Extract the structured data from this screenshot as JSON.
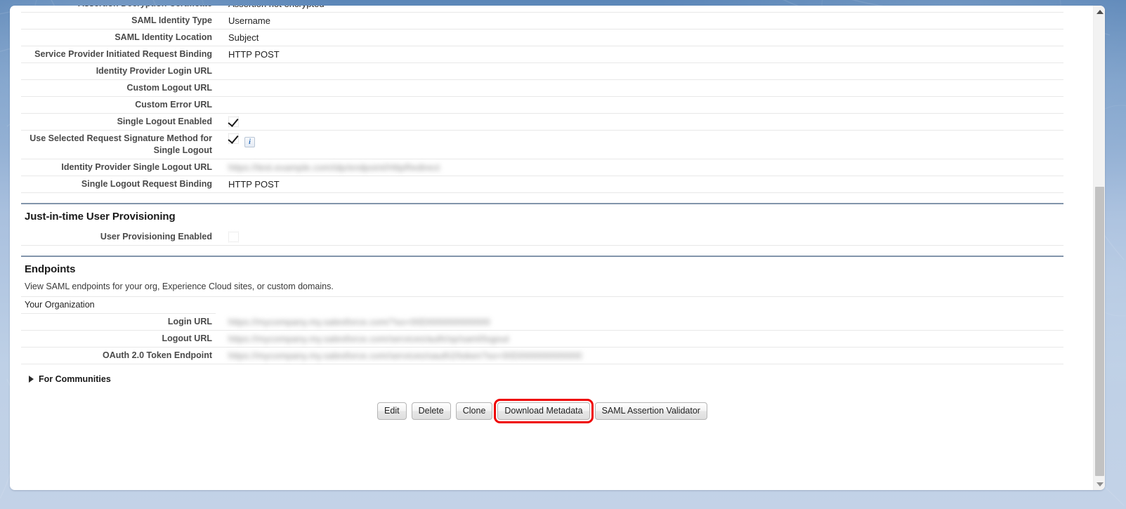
{
  "window": {
    "scrollbar": {
      "up_arrow": "scroll-up",
      "down_arrow": "scroll-down"
    }
  },
  "details": {
    "rows": [
      {
        "label": "Assertion Decryption Certificate",
        "value": "Assertion not encrypted",
        "type": "text"
      },
      {
        "label": "SAML Identity Type",
        "value": "Username",
        "type": "text"
      },
      {
        "label": "SAML Identity Location",
        "value": "Subject",
        "type": "text"
      },
      {
        "label": "Service Provider Initiated Request Binding",
        "value": "HTTP POST",
        "type": "text"
      },
      {
        "label": "Identity Provider Login URL",
        "value": "",
        "type": "text"
      },
      {
        "label": "Custom Logout URL",
        "value": "",
        "type": "text"
      },
      {
        "label": "Custom Error URL",
        "value": "",
        "type": "text"
      },
      {
        "label": "Single Logout Enabled",
        "value": "checked",
        "type": "checkbox"
      },
      {
        "label": "Use Selected Request Signature Method for Single Logout",
        "value": "checked",
        "type": "checkbox-info",
        "info_icon": "info-icon"
      },
      {
        "label": "Identity Provider Single Logout URL",
        "value": "https://test.example.com/idp/endpoint/HttpRedirect",
        "type": "redacted"
      },
      {
        "label": "Single Logout Request Binding",
        "value": "HTTP POST",
        "type": "text"
      }
    ]
  },
  "jit": {
    "title": "Just-in-time User Provisioning",
    "rows": [
      {
        "label": "User Provisioning Enabled",
        "value": "unchecked",
        "type": "checkbox"
      }
    ]
  },
  "endpoints": {
    "title": "Endpoints",
    "description": "View SAML endpoints for your org, Experience Cloud sites, or custom domains.",
    "subhead": "Your Organization",
    "rows": [
      {
        "label": "Login URL",
        "value": "https://mycompany.my.salesforce.com/?so=00D000000000000",
        "type": "redacted"
      },
      {
        "label": "Logout URL",
        "value": "https://mycompany.my.salesforce.com/services/auth/sp/saml/logout",
        "type": "redacted"
      },
      {
        "label": "OAuth 2.0 Token Endpoint",
        "value": "https://mycompany.my.salesforce.com/services/oauth2/token?so=00D000000000000",
        "type": "redacted"
      }
    ],
    "communities_label": "For Communities"
  },
  "actions": {
    "buttons": [
      {
        "label": "Edit",
        "highlighted": false
      },
      {
        "label": "Delete",
        "highlighted": false
      },
      {
        "label": "Clone",
        "highlighted": false
      },
      {
        "label": "Download Metadata",
        "highlighted": true
      },
      {
        "label": "SAML Assertion Validator",
        "highlighted": false
      }
    ],
    "highlight_color": "#ef0000"
  }
}
